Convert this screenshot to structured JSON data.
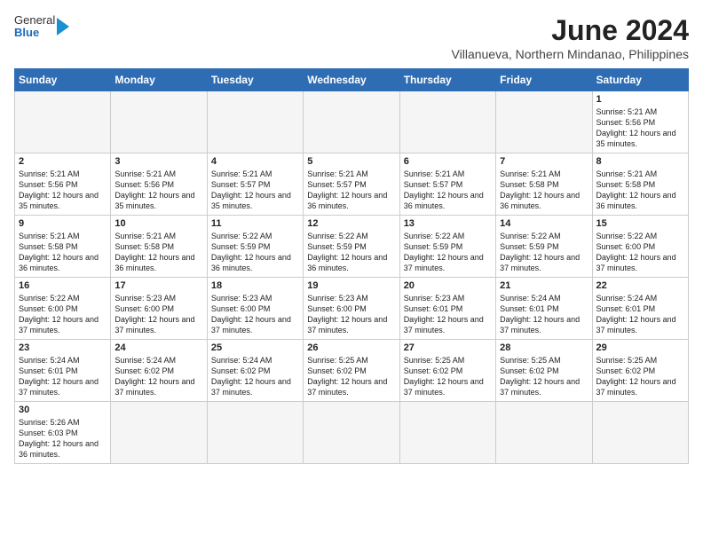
{
  "header": {
    "logo": {
      "general": "General",
      "blue": "Blue"
    },
    "title": "June 2024",
    "subtitle": "Villanueva, Northern Mindanao, Philippines"
  },
  "days_of_week": [
    "Sunday",
    "Monday",
    "Tuesday",
    "Wednesday",
    "Thursday",
    "Friday",
    "Saturday"
  ],
  "weeks": [
    [
      {
        "day": null,
        "info": null
      },
      {
        "day": null,
        "info": null
      },
      {
        "day": null,
        "info": null
      },
      {
        "day": null,
        "info": null
      },
      {
        "day": null,
        "info": null
      },
      {
        "day": null,
        "info": null
      },
      {
        "day": "1",
        "info": "Sunrise: 5:21 AM\nSunset: 5:56 PM\nDaylight: 12 hours and 35 minutes."
      }
    ],
    [
      {
        "day": "2",
        "info": "Sunrise: 5:21 AM\nSunset: 5:56 PM\nDaylight: 12 hours and 35 minutes."
      },
      {
        "day": "3",
        "info": "Sunrise: 5:21 AM\nSunset: 5:56 PM\nDaylight: 12 hours and 35 minutes."
      },
      {
        "day": "4",
        "info": "Sunrise: 5:21 AM\nSunset: 5:57 PM\nDaylight: 12 hours and 35 minutes."
      },
      {
        "day": "5",
        "info": "Sunrise: 5:21 AM\nSunset: 5:57 PM\nDaylight: 12 hours and 36 minutes."
      },
      {
        "day": "6",
        "info": "Sunrise: 5:21 AM\nSunset: 5:57 PM\nDaylight: 12 hours and 36 minutes."
      },
      {
        "day": "7",
        "info": "Sunrise: 5:21 AM\nSunset: 5:58 PM\nDaylight: 12 hours and 36 minutes."
      },
      {
        "day": "8",
        "info": "Sunrise: 5:21 AM\nSunset: 5:58 PM\nDaylight: 12 hours and 36 minutes."
      }
    ],
    [
      {
        "day": "9",
        "info": "Sunrise: 5:21 AM\nSunset: 5:58 PM\nDaylight: 12 hours and 36 minutes."
      },
      {
        "day": "10",
        "info": "Sunrise: 5:21 AM\nSunset: 5:58 PM\nDaylight: 12 hours and 36 minutes."
      },
      {
        "day": "11",
        "info": "Sunrise: 5:22 AM\nSunset: 5:59 PM\nDaylight: 12 hours and 36 minutes."
      },
      {
        "day": "12",
        "info": "Sunrise: 5:22 AM\nSunset: 5:59 PM\nDaylight: 12 hours and 36 minutes."
      },
      {
        "day": "13",
        "info": "Sunrise: 5:22 AM\nSunset: 5:59 PM\nDaylight: 12 hours and 37 minutes."
      },
      {
        "day": "14",
        "info": "Sunrise: 5:22 AM\nSunset: 5:59 PM\nDaylight: 12 hours and 37 minutes."
      },
      {
        "day": "15",
        "info": "Sunrise: 5:22 AM\nSunset: 6:00 PM\nDaylight: 12 hours and 37 minutes."
      }
    ],
    [
      {
        "day": "16",
        "info": "Sunrise: 5:22 AM\nSunset: 6:00 PM\nDaylight: 12 hours and 37 minutes."
      },
      {
        "day": "17",
        "info": "Sunrise: 5:23 AM\nSunset: 6:00 PM\nDaylight: 12 hours and 37 minutes."
      },
      {
        "day": "18",
        "info": "Sunrise: 5:23 AM\nSunset: 6:00 PM\nDaylight: 12 hours and 37 minutes."
      },
      {
        "day": "19",
        "info": "Sunrise: 5:23 AM\nSunset: 6:00 PM\nDaylight: 12 hours and 37 minutes."
      },
      {
        "day": "20",
        "info": "Sunrise: 5:23 AM\nSunset: 6:01 PM\nDaylight: 12 hours and 37 minutes."
      },
      {
        "day": "21",
        "info": "Sunrise: 5:24 AM\nSunset: 6:01 PM\nDaylight: 12 hours and 37 minutes."
      },
      {
        "day": "22",
        "info": "Sunrise: 5:24 AM\nSunset: 6:01 PM\nDaylight: 12 hours and 37 minutes."
      }
    ],
    [
      {
        "day": "23",
        "info": "Sunrise: 5:24 AM\nSunset: 6:01 PM\nDaylight: 12 hours and 37 minutes."
      },
      {
        "day": "24",
        "info": "Sunrise: 5:24 AM\nSunset: 6:02 PM\nDaylight: 12 hours and 37 minutes."
      },
      {
        "day": "25",
        "info": "Sunrise: 5:24 AM\nSunset: 6:02 PM\nDaylight: 12 hours and 37 minutes."
      },
      {
        "day": "26",
        "info": "Sunrise: 5:25 AM\nSunset: 6:02 PM\nDaylight: 12 hours and 37 minutes."
      },
      {
        "day": "27",
        "info": "Sunrise: 5:25 AM\nSunset: 6:02 PM\nDaylight: 12 hours and 37 minutes."
      },
      {
        "day": "28",
        "info": "Sunrise: 5:25 AM\nSunset: 6:02 PM\nDaylight: 12 hours and 37 minutes."
      },
      {
        "day": "29",
        "info": "Sunrise: 5:25 AM\nSunset: 6:02 PM\nDaylight: 12 hours and 37 minutes."
      }
    ],
    [
      {
        "day": "30",
        "info": "Sunrise: 5:26 AM\nSunset: 6:03 PM\nDaylight: 12 hours and 36 minutes."
      },
      {
        "day": null,
        "info": null
      },
      {
        "day": null,
        "info": null
      },
      {
        "day": null,
        "info": null
      },
      {
        "day": null,
        "info": null
      },
      {
        "day": null,
        "info": null
      },
      {
        "day": null,
        "info": null
      }
    ]
  ]
}
